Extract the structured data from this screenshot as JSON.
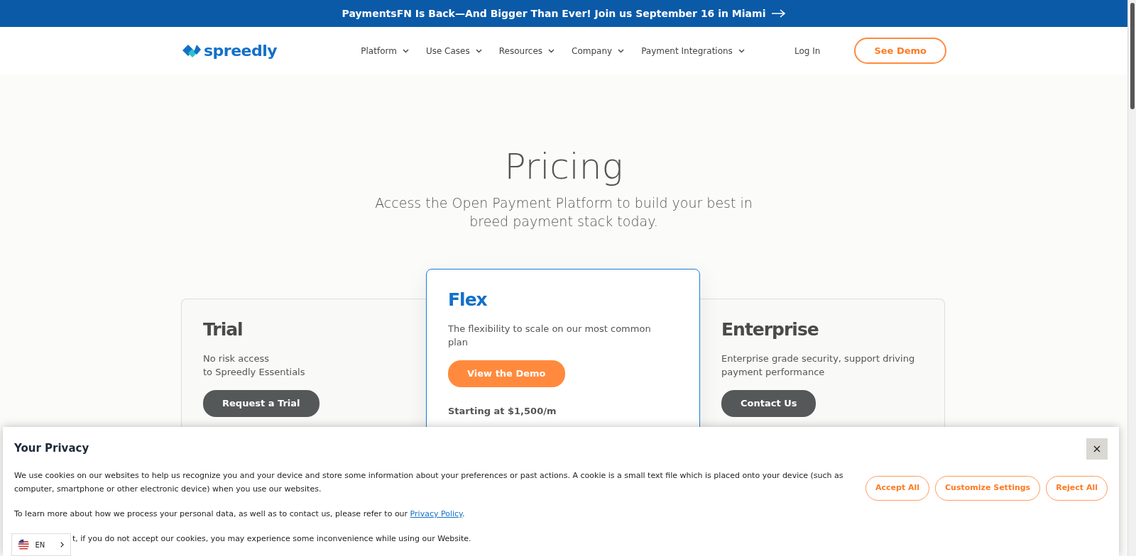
{
  "announcement": {
    "text": "PaymentsFN Is Back—And Bigger Than Ever! Join us September 16 in Miami"
  },
  "logo": {
    "text": "spreedly"
  },
  "nav": {
    "items": [
      {
        "label": "Platform",
        "has_menu": true
      },
      {
        "label": "Use Cases",
        "has_menu": true
      },
      {
        "label": "Resources",
        "has_menu": true
      },
      {
        "label": "Company",
        "has_menu": true
      },
      {
        "label": "Payment Integrations",
        "has_menu": true
      }
    ],
    "login": "Log In",
    "cta": "See Demo"
  },
  "hero": {
    "title": "Pricing",
    "subtitle_lines": [
      "Access the Open Payment Platform to build your best in",
      "breed payment stack today."
    ]
  },
  "plans": [
    {
      "name": "Trial",
      "featured": false,
      "description_lines": [
        "No risk access",
        "to Spreedly Essentials"
      ],
      "button": "Request a Trial"
    },
    {
      "name": "Flex",
      "featured": true,
      "description_lines": [
        "The flexibility to scale on our most common",
        "plan"
      ],
      "button": "View the Demo",
      "price": "Starting at $1,500/m"
    },
    {
      "name": "Enterprise",
      "featured": false,
      "description_lines": [
        "Enterprise grade security, support driving",
        "payment performance"
      ],
      "button": "Contact Us"
    }
  ],
  "cookie_banner": {
    "title": "Your Privacy",
    "close": "×",
    "paragraphs": [
      {
        "text": "We use cookies on our websites to help us recognize you and your device and store some information about your preferences or past actions. A cookie is a small text file which is placed onto your device (such as computer, smartphone or other electronic device) when you use our websites."
      },
      {
        "text": "To learn more about how we process your personal data, as well as to contact us, please refer to our ",
        "link": "Privacy Policy",
        "after": "."
      },
      {
        "text": "t, if you do not accept our cookies, you may experience some inconvenience while using our Website."
      }
    ],
    "buttons": [
      "Accept All",
      "Customize Settings",
      "Reject All"
    ]
  },
  "language": {
    "label": "EN"
  }
}
